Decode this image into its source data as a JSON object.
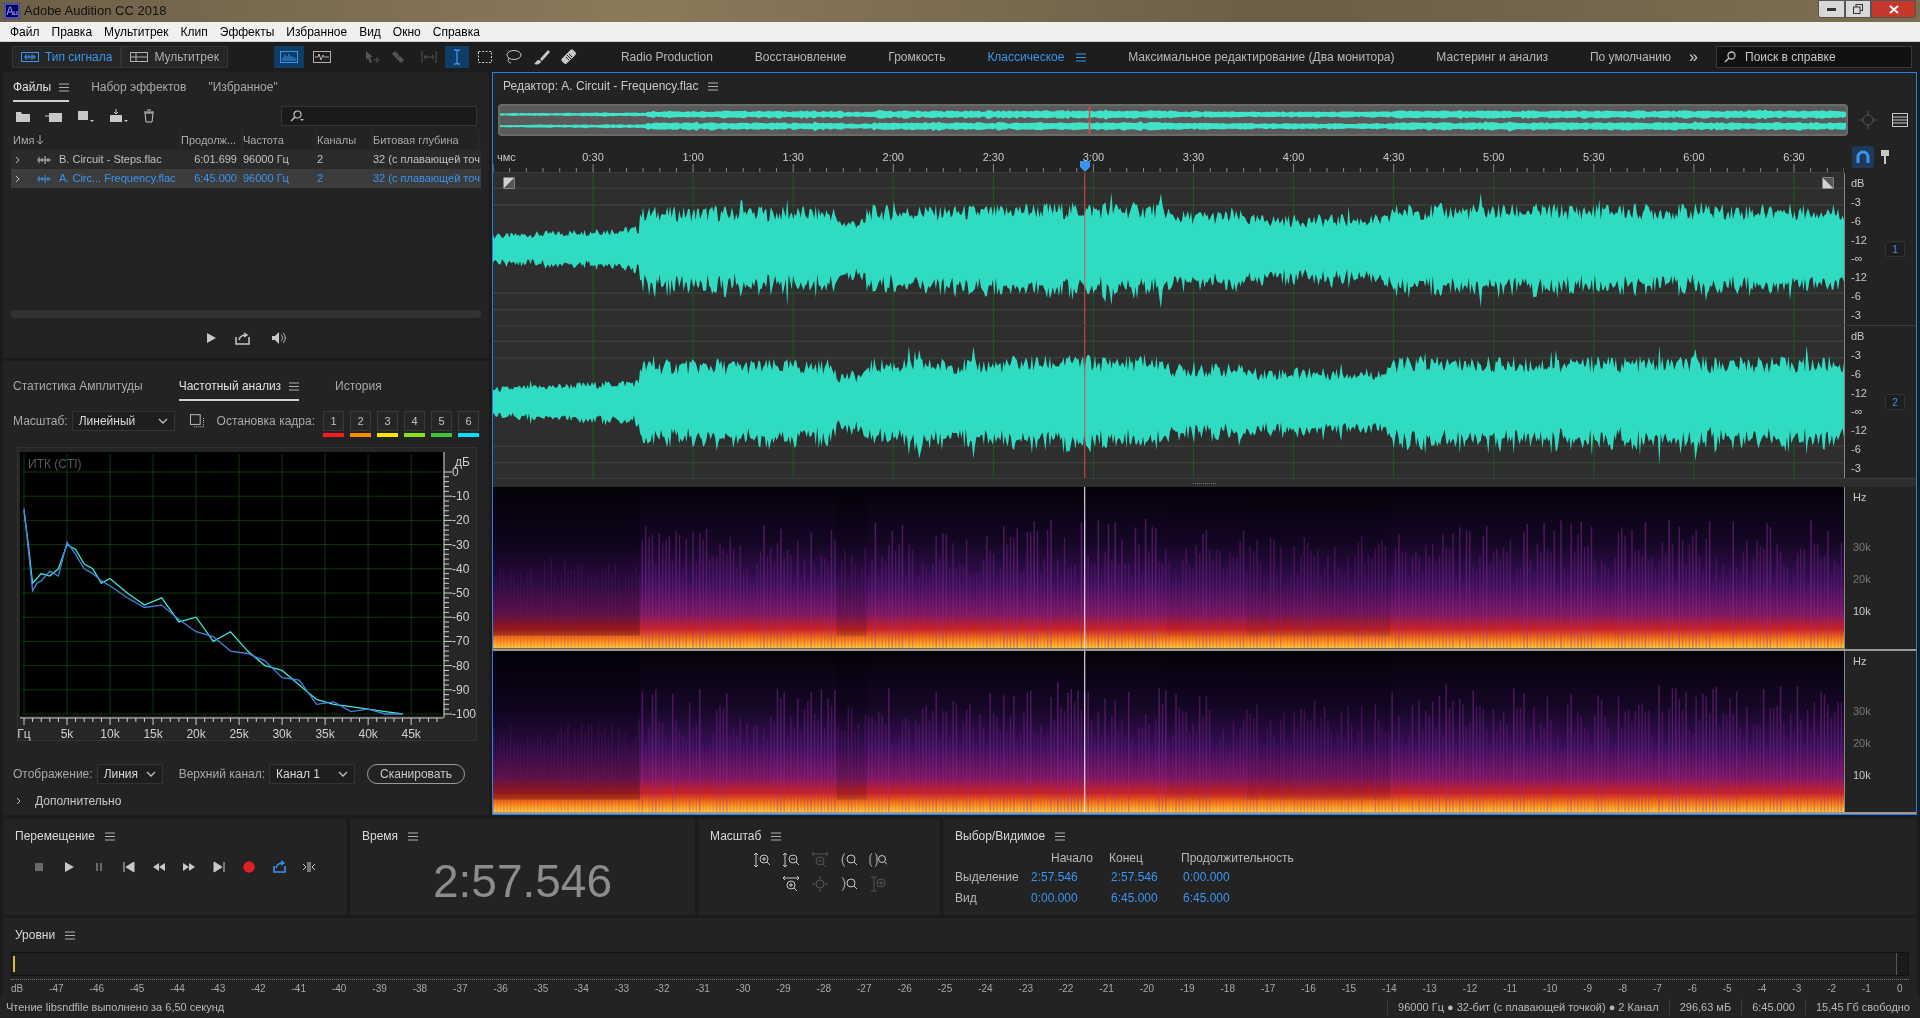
{
  "window": {
    "title": "Adobe Audition CC 2018"
  },
  "menu": [
    "Файл",
    "Правка",
    "Мультитрек",
    "Клип",
    "Эффекты",
    "Избранное",
    "Вид",
    "Окно",
    "Справка"
  ],
  "toolbar": {
    "modes": [
      {
        "kind": "waveform",
        "label": "Тип сигнала",
        "selected": true
      },
      {
        "kind": "multitrack",
        "label": "Мультитрек",
        "selected": false
      }
    ],
    "view_buttons": [
      {
        "kind": "spectrum",
        "selected": true
      },
      {
        "kind": "waveform",
        "selected": false
      }
    ],
    "tools": [
      {
        "kind": "move",
        "selected": false,
        "disabled": true
      },
      {
        "kind": "razor",
        "selected": false,
        "disabled": true
      },
      {
        "kind": "slip",
        "selected": false,
        "disabled": true
      },
      {
        "kind": "time",
        "selected": true,
        "disabled": false
      },
      {
        "kind": "marquee",
        "selected": false,
        "disabled": false
      },
      {
        "kind": "lasso",
        "selected": false,
        "disabled": false
      },
      {
        "kind": "brush",
        "selected": false,
        "disabled": false
      },
      {
        "kind": "healing",
        "selected": false,
        "disabled": false
      }
    ],
    "workspaces": [
      {
        "label": "Radio Production",
        "selected": false
      },
      {
        "label": "Восстановление",
        "selected": false
      },
      {
        "label": "Громкость",
        "selected": false
      },
      {
        "label": "Классическое",
        "selected": true
      },
      {
        "label": "Максимальное редактирование (Два монитора)",
        "selected": false
      },
      {
        "label": "Мастеринг и анализ",
        "selected": false
      },
      {
        "label": "По умолчанию",
        "selected": false
      }
    ],
    "more": "»",
    "search": {
      "placeholder": "Поиск в справке"
    }
  },
  "files_panel": {
    "tabs": [
      {
        "label": "Файлы",
        "selected": true
      },
      {
        "label": "Набор эффектов",
        "selected": false
      },
      {
        "label": "\"Избранное\"",
        "selected": false
      }
    ],
    "columns": [
      "Имя",
      "Продолж...",
      "Частота",
      "Каналы",
      "Битовая глубина"
    ],
    "rows": [
      {
        "name": "B. Circuit - Steps.flac",
        "duration": "6:01.699",
        "rate": "96000 Гц",
        "channels": "2",
        "bit_depth": "32 (с плавающей точ",
        "selected": false
      },
      {
        "name": "A. Circ... Frequency.flac",
        "duration": "6:45.000",
        "rate": "96000 Гц",
        "channels": "2",
        "bit_depth": "32 (с плавающей точ",
        "selected": true
      }
    ]
  },
  "frequency_panel": {
    "tabs": [
      {
        "label": "Статистика Амплитуды",
        "selected": false
      },
      {
        "label": "Частотный анализ",
        "selected": true
      },
      {
        "label": "История",
        "selected": false
      }
    ],
    "scale_label": "Масштаб:",
    "scale_value": "Линейный",
    "freeze_label": "Остановка кадра:",
    "freeze_buttons": [
      {
        "label": "1",
        "color": "#ff1a1a"
      },
      {
        "label": "2",
        "color": "#ff8a00"
      },
      {
        "label": "3",
        "color": "#ffe600"
      },
      {
        "label": "4",
        "color": "#8ae01a"
      },
      {
        "label": "5",
        "color": "#3cc43c"
      },
      {
        "label": "6",
        "color": "#00e0ff"
      }
    ],
    "chart_data": {
      "type": "line",
      "title": "ИТК (CTI)",
      "ylabel": "дБ",
      "x": [
        0,
        500,
        1000,
        1500,
        2000,
        3000,
        4000,
        5000,
        6000,
        7000,
        8000,
        9000,
        10000,
        12000,
        14000,
        16000,
        18000,
        20000,
        22000,
        24000,
        26000,
        28000,
        30000,
        32000,
        34000,
        36000,
        38000,
        40000,
        42000,
        44000
      ],
      "series": [
        {
          "color": "#3fe8d4",
          "values": [
            -16,
            -30,
            -46,
            -44,
            -42,
            -43,
            -40,
            -30,
            -32,
            -38,
            -40,
            -46,
            -44,
            -50,
            -55,
            -52,
            -62,
            -60,
            -70,
            -66,
            -74,
            -80,
            -82,
            -88,
            -94,
            -96,
            -97,
            -98,
            -99,
            -100
          ]
        },
        {
          "color": "#4a7fe0",
          "values": [
            -15,
            -32,
            -49,
            -46,
            -45,
            -41,
            -43,
            -29,
            -34,
            -40,
            -42,
            -45,
            -47,
            -52,
            -56,
            -55,
            -61,
            -66,
            -68,
            -74,
            -75,
            -78,
            -85,
            -86,
            -96,
            -95,
            -99,
            -98,
            -100,
            -100
          ]
        }
      ],
      "xlim": [
        0,
        48700
      ],
      "ylim": [
        -100,
        0
      ],
      "grid": true,
      "xticks": [
        {
          "value": 0,
          "label": "Гц"
        },
        {
          "value": 5000,
          "label": "5k"
        },
        {
          "value": 10000,
          "label": "10k"
        },
        {
          "value": 15000,
          "label": "15k"
        },
        {
          "value": 20000,
          "label": "20k"
        },
        {
          "value": 25000,
          "label": "25k"
        },
        {
          "value": 30000,
          "label": "30k"
        },
        {
          "value": 35000,
          "label": "35k"
        },
        {
          "value": 40000,
          "label": "40k"
        },
        {
          "value": 45000,
          "label": "45k"
        }
      ],
      "yticks": [
        0,
        -10,
        -20,
        -30,
        -40,
        -50,
        -60,
        -70,
        -80,
        -90,
        -100
      ]
    },
    "display_label": "Отображение:",
    "display_value": "Линия",
    "channel_label": "Верхний канал:",
    "channel_value": "Канал 1",
    "scan_button": "Сканировать",
    "advanced": {
      "label": "Дополнительно",
      "expanded": false
    }
  },
  "editor": {
    "title": "Редактор: A. Circuit - Frequency.flac",
    "ruler": [
      "чмс",
      "0:30",
      "1:00",
      "1:30",
      "2:00",
      "2:30",
      "3:00",
      "3:30",
      "4:00",
      "4:30",
      "5:00",
      "5:30",
      "6:00",
      "6:30"
    ],
    "playhead": {
      "level": 0.438
    },
    "snap": {
      "on": true
    },
    "channels": [
      {
        "badge": "1",
        "db_scale": [
          "dB",
          "-3",
          "-6",
          "-12",
          "-∞",
          "-12",
          "-6",
          "-3"
        ]
      },
      {
        "badge": "2",
        "db_scale": [
          "dB",
          "-3",
          "-6",
          "-12",
          "-∞",
          "-12",
          "-6",
          "-3"
        ]
      }
    ],
    "spectral_channels": [
      {
        "hz_scale": [
          "Hz",
          "30k",
          "20k",
          "10k"
        ]
      },
      {
        "hz_scale": [
          "Hz",
          "30k",
          "20k",
          "10k"
        ]
      }
    ]
  },
  "transport": {
    "title": "Перемещение",
    "buttons": [
      {
        "kind": "stop",
        "on": false
      },
      {
        "kind": "play",
        "on": false
      },
      {
        "kind": "pause",
        "on": false
      },
      {
        "kind": "start",
        "on": false
      },
      {
        "kind": "rewind",
        "on": false
      },
      {
        "kind": "forward",
        "on": false
      },
      {
        "kind": "end",
        "on": false
      },
      {
        "kind": "record",
        "on": false
      },
      {
        "kind": "loop",
        "on": true
      },
      {
        "kind": "skip",
        "on": false
      }
    ]
  },
  "time": {
    "title": "Время",
    "value": "2:57.546"
  },
  "zoom": {
    "title": "Масштаб",
    "rows": [
      [
        {
          "kind": "amp_in",
          "disabled": false
        },
        {
          "kind": "amp_out",
          "disabled": false
        },
        {
          "kind": "out_full",
          "disabled": true
        },
        {
          "kind": "in_start",
          "disabled": false
        },
        {
          "kind": "in_both",
          "disabled": false
        }
      ],
      [
        {
          "kind": "time_in",
          "disabled": false
        },
        {
          "kind": "out_all",
          "disabled": true
        },
        {
          "kind": "in_end",
          "disabled": false
        },
        {
          "kind": "selection",
          "disabled": true
        }
      ]
    ]
  },
  "selection": {
    "title": "Выбор/Видимое",
    "columns": [
      "Начало",
      "Конец",
      "Продолжительность"
    ],
    "rows": [
      {
        "label": "Выделение",
        "values": [
          "2:57.546",
          "2:57.546",
          "0:00.000"
        ]
      },
      {
        "label": "Вид",
        "values": [
          "0:00.000",
          "6:45.000",
          "6:45.000"
        ]
      }
    ]
  },
  "levels": {
    "title": "Уровни",
    "scale": [
      "dB",
      "-47",
      "-46",
      "-45",
      "-44",
      "-43",
      "-42",
      "-41",
      "-40",
      "-39",
      "-38",
      "-37",
      "-36",
      "-35",
      "-34",
      "-33",
      "-32",
      "-31",
      "-30",
      "-29",
      "-28",
      "-27",
      "-26",
      "-25",
      "-24",
      "-23",
      "-22",
      "-21",
      "-20",
      "-19",
      "-18",
      "-17",
      "-16",
      "-15",
      "-14",
      "-13",
      "-12",
      "-11",
      "-10",
      "-9",
      "-8",
      "-7",
      "-6",
      "-5",
      "-4",
      "-3",
      "-2",
      "-1",
      "0"
    ]
  },
  "status_bar": {
    "message": "Чтение libsndfile выполнено за 6,50 секунд",
    "fields": [
      "96000 Гц ● 32-бит (с плавающей точкой) ● 2 Канал",
      "296,63 мБ",
      "6:45.000",
      "15,45 Гб свободно"
    ]
  }
}
